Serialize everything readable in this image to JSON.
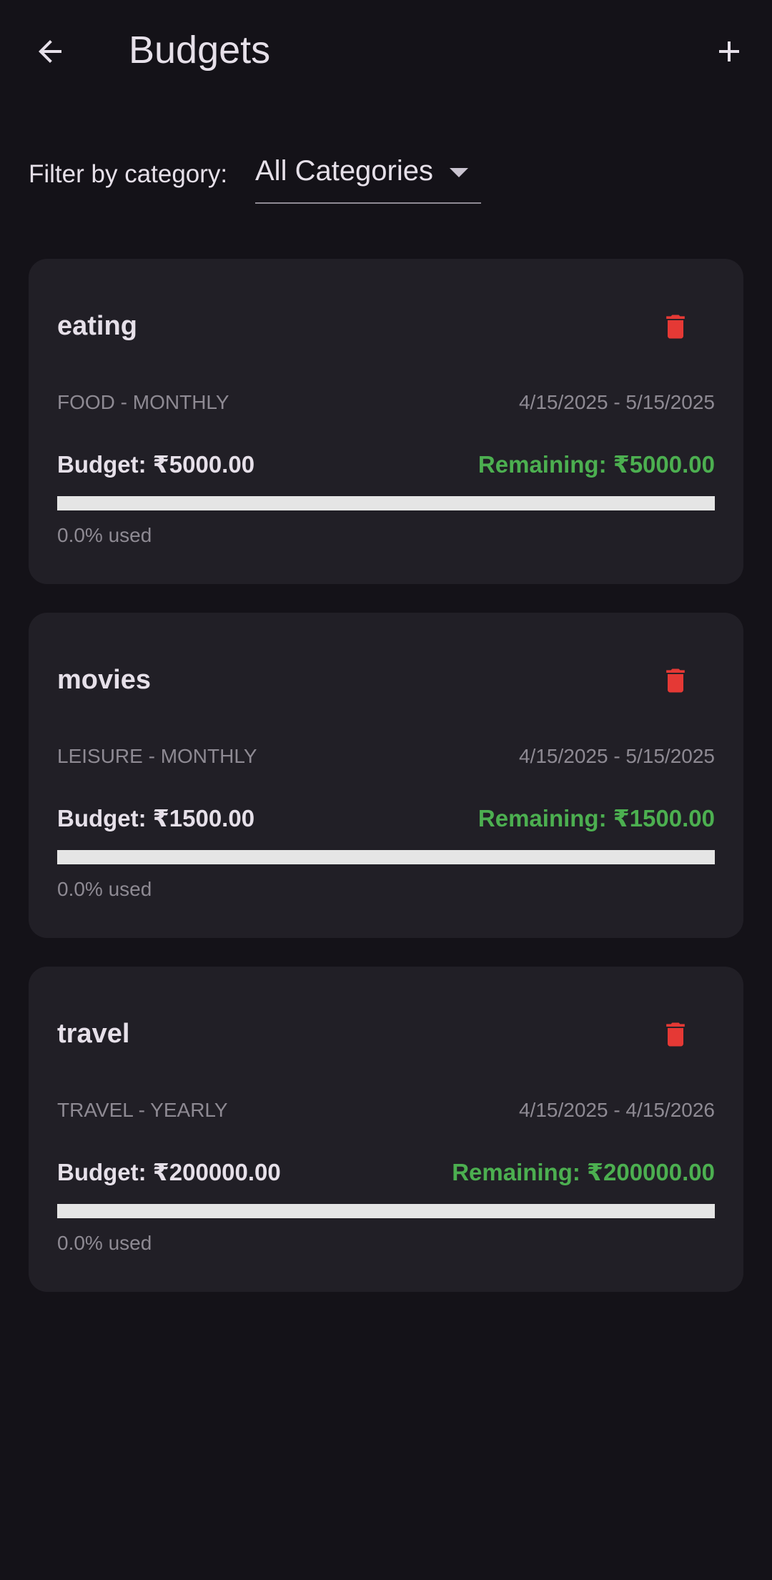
{
  "app_bar": {
    "title": "Budgets",
    "back_icon": "arrow-back-icon",
    "add_icon": "add-icon"
  },
  "filter": {
    "label": "Filter by category:",
    "selected": "All Categories"
  },
  "colors": {
    "background": "#141218",
    "card": "#211f26",
    "remaining_green": "#4caf50",
    "delete_red": "#e53935",
    "muted_text": "#8e8a93"
  },
  "budgets": [
    {
      "name": "eating",
      "meta": "FOOD - MONTHLY",
      "dates": "4/15/2025 - 5/15/2025",
      "budget": "Budget: ₹5000.00",
      "remaining": "Remaining: ₹5000.00",
      "used_text": "0.0% used",
      "used_fraction": 0
    },
    {
      "name": "movies",
      "meta": "LEISURE - MONTHLY",
      "dates": "4/15/2025 - 5/15/2025",
      "budget": "Budget: ₹1500.00",
      "remaining": "Remaining: ₹1500.00",
      "used_text": "0.0% used",
      "used_fraction": 0
    },
    {
      "name": "travel",
      "meta": "TRAVEL - YEARLY",
      "dates": "4/15/2025 - 4/15/2026",
      "budget": "Budget: ₹200000.00",
      "remaining": "Remaining: ₹200000.00",
      "used_text": "0.0% used",
      "used_fraction": 0
    }
  ]
}
